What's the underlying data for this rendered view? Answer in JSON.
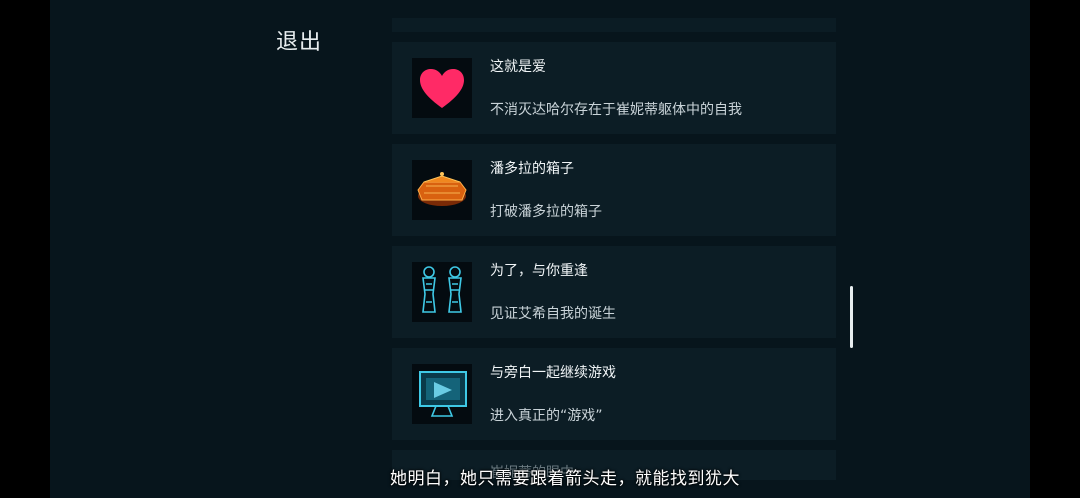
{
  "header": {
    "exit_label": "退出"
  },
  "achievements": [
    {
      "title": "这就是爱",
      "desc": "不消灭达哈尔存在于崔妮蒂躯体中的自我",
      "icon": "heart-icon"
    },
    {
      "title": "潘多拉的箱子",
      "desc": "打破潘多拉的箱子",
      "icon": "pandora-box-icon"
    },
    {
      "title": "为了，与你重逢",
      "desc": "见证艾希自我的诞生",
      "icon": "twin-figures-icon"
    },
    {
      "title": "与旁白一起继续游戏",
      "desc": "进入真正的“游戏”",
      "icon": "monitor-icon"
    },
    {
      "title": "崔妮蒂的眼中",
      "desc": "",
      "icon": ""
    }
  ],
  "subtitle": "她明白，她只需要跟着箭头走，就能找到犹大"
}
